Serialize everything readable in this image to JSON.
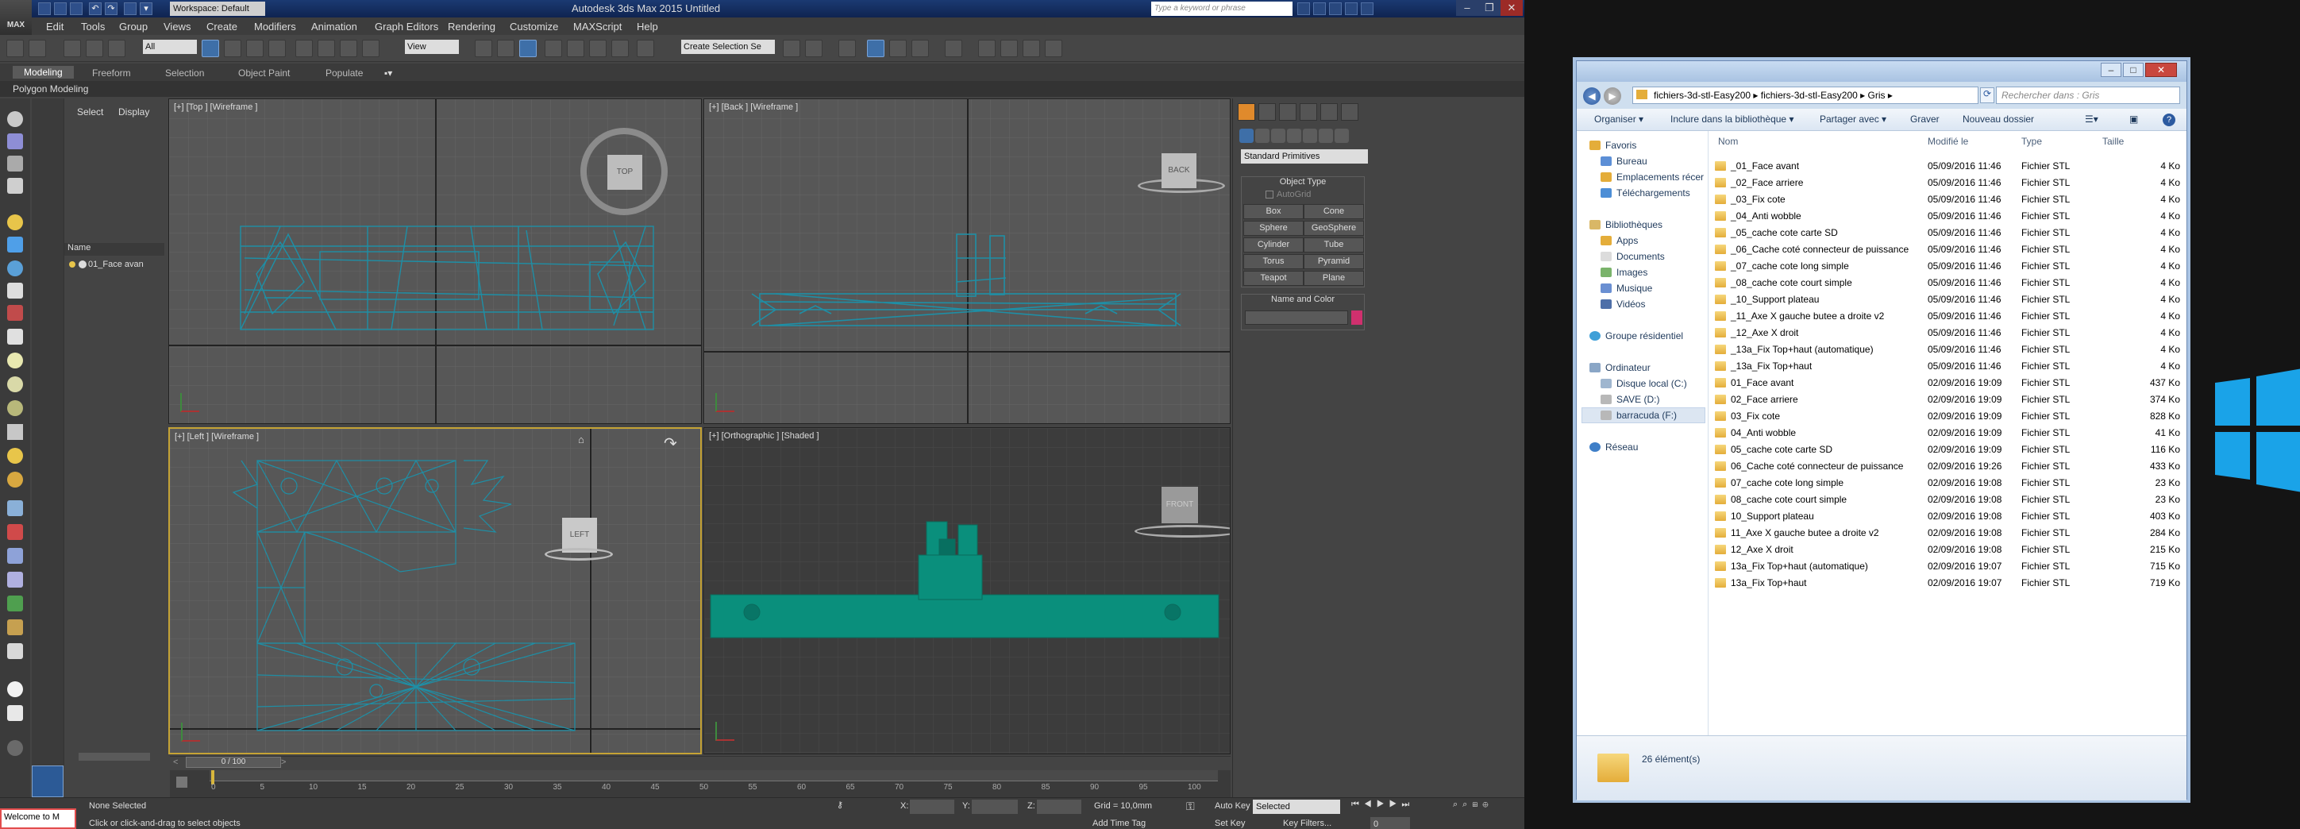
{
  "max": {
    "logo": "MAX",
    "workspace": "Workspace: Default",
    "title": "Autodesk 3ds Max 2015     Untitled",
    "search_placeholder": "Type a keyword or phrase",
    "menus": [
      "Edit",
      "Tools",
      "Group",
      "Views",
      "Create",
      "Modifiers",
      "Animation",
      "Graph Editors",
      "Rendering",
      "Customize",
      "MAXScript",
      "Help"
    ],
    "toolbar": {
      "selection_filter": "All",
      "ref_coord": "View",
      "named_selection": "Create Selection Se"
    },
    "ribbon_tabs": [
      "Modeling",
      "Freeform",
      "Selection",
      "Object Paint",
      "Populate"
    ],
    "ribbon_active": "Modeling",
    "polygon_modeling": "Polygon Modeling",
    "explorer": {
      "tabs": [
        "Select",
        "Display"
      ],
      "col_name": "Name",
      "item": "01_Face avan"
    },
    "viewports": {
      "top": {
        "label": "[+] [Top ] [Wireframe ]",
        "cube": "TOP"
      },
      "back": {
        "label": "[+] [Back ] [Wireframe ]",
        "cube": "BACK"
      },
      "left": {
        "label": "[+] [Left ] [Wireframe ]",
        "cube": "LEFT"
      },
      "persp": {
        "label": "[+] [Orthographic ] [Shaded ]",
        "cube": "FRONT"
      }
    },
    "command_panel": {
      "dropdown": "Standard Primitives",
      "object_type_title": "Object Type",
      "autogrid": "AutoGrid",
      "buttons": [
        "Box",
        "Cone",
        "Sphere",
        "GeoSphere",
        "Cylinder",
        "Tube",
        "Torus",
        "Pyramid",
        "Teapot",
        "Plane"
      ],
      "name_color_title": "Name and Color"
    },
    "time": {
      "slider": "0 / 100",
      "ticks": [
        "0",
        "5",
        "10",
        "15",
        "20",
        "25",
        "30",
        "35",
        "40",
        "45",
        "50",
        "55",
        "60",
        "65",
        "70",
        "75",
        "80",
        "85",
        "90",
        "95",
        "100"
      ]
    },
    "status": {
      "selected": "None Selected",
      "prompt": "Click or click-and-drag to select objects",
      "x": "X:",
      "y": "Y:",
      "z": "Z:",
      "grid": "Grid = 10,0mm",
      "add_time_tag": "Add Time Tag",
      "auto_key": "Auto Key",
      "set_key": "Set Key",
      "selected_dd": "Selected",
      "key_filters": "Key Filters...",
      "frame": "0",
      "maxscript": "Welcome to M"
    },
    "colors": {
      "mesh": "#1e8fa6",
      "shaded": "#0a8f7c",
      "name_swatch": "#d0306e"
    }
  },
  "explorer_window": {
    "path": [
      "fichiers-3d-stl-Easy200",
      "fichiers-3d-stl-Easy200",
      "Gris"
    ],
    "search_placeholder": "Rechercher dans : Gris",
    "commands": [
      "Organiser ▾",
      "Inclure dans la bibliothèque ▾",
      "Partager avec ▾",
      "Graver",
      "Nouveau dossier"
    ],
    "nav": {
      "favorites": "Favoris",
      "fav_items": [
        "Bureau",
        "Emplacements récer",
        "Téléchargements"
      ],
      "libraries": "Bibliothèques",
      "lib_items": [
        "Apps",
        "Documents",
        "Images",
        "Musique",
        "Vidéos"
      ],
      "homegroup": "Groupe résidentiel",
      "computer": "Ordinateur",
      "drives": [
        "Disque local (C:)",
        "SAVE (D:)",
        "barracuda (F:)"
      ],
      "network": "Réseau"
    },
    "columns": [
      "Nom",
      "Modifié le",
      "Type",
      "Taille"
    ],
    "files": [
      {
        "name": "_01_Face avant",
        "date": "05/09/2016 11:46",
        "type": "Fichier STL",
        "size": "4 Ko"
      },
      {
        "name": "_02_Face arriere",
        "date": "05/09/2016 11:46",
        "type": "Fichier STL",
        "size": "4 Ko"
      },
      {
        "name": "_03_Fix cote",
        "date": "05/09/2016 11:46",
        "type": "Fichier STL",
        "size": "4 Ko"
      },
      {
        "name": "_04_Anti wobble",
        "date": "05/09/2016 11:46",
        "type": "Fichier STL",
        "size": "4 Ko"
      },
      {
        "name": "_05_cache cote carte SD",
        "date": "05/09/2016 11:46",
        "type": "Fichier STL",
        "size": "4 Ko"
      },
      {
        "name": "_06_Cache coté connecteur de puissance",
        "date": "05/09/2016 11:46",
        "type": "Fichier STL",
        "size": "4 Ko"
      },
      {
        "name": "_07_cache cote long simple",
        "date": "05/09/2016 11:46",
        "type": "Fichier STL",
        "size": "4 Ko"
      },
      {
        "name": "_08_cache cote court simple",
        "date": "05/09/2016 11:46",
        "type": "Fichier STL",
        "size": "4 Ko"
      },
      {
        "name": "_10_Support plateau",
        "date": "05/09/2016 11:46",
        "type": "Fichier STL",
        "size": "4 Ko"
      },
      {
        "name": "_11_Axe X gauche butee a droite v2",
        "date": "05/09/2016 11:46",
        "type": "Fichier STL",
        "size": "4 Ko"
      },
      {
        "name": "_12_Axe X droit",
        "date": "05/09/2016 11:46",
        "type": "Fichier STL",
        "size": "4 Ko"
      },
      {
        "name": "_13a_Fix Top+haut (automatique)",
        "date": "05/09/2016 11:46",
        "type": "Fichier STL",
        "size": "4 Ko"
      },
      {
        "name": "_13a_Fix Top+haut",
        "date": "05/09/2016 11:46",
        "type": "Fichier STL",
        "size": "4 Ko"
      },
      {
        "name": "01_Face avant",
        "date": "02/09/2016 19:09",
        "type": "Fichier STL",
        "size": "437 Ko"
      },
      {
        "name": "02_Face arriere",
        "date": "02/09/2016 19:09",
        "type": "Fichier STL",
        "size": "374 Ko"
      },
      {
        "name": "03_Fix cote",
        "date": "02/09/2016 19:09",
        "type": "Fichier STL",
        "size": "828 Ko"
      },
      {
        "name": "04_Anti wobble",
        "date": "02/09/2016 19:09",
        "type": "Fichier STL",
        "size": "41 Ko"
      },
      {
        "name": "05_cache cote carte SD",
        "date": "02/09/2016 19:09",
        "type": "Fichier STL",
        "size": "116 Ko"
      },
      {
        "name": "06_Cache coté connecteur de puissance",
        "date": "02/09/2016 19:26",
        "type": "Fichier STL",
        "size": "433 Ko"
      },
      {
        "name": "07_cache cote long simple",
        "date": "02/09/2016 19:08",
        "type": "Fichier STL",
        "size": "23 Ko"
      },
      {
        "name": "08_cache cote court simple",
        "date": "02/09/2016 19:08",
        "type": "Fichier STL",
        "size": "23 Ko"
      },
      {
        "name": "10_Support plateau",
        "date": "02/09/2016 19:08",
        "type": "Fichier STL",
        "size": "403 Ko"
      },
      {
        "name": "11_Axe X gauche butee a droite v2",
        "date": "02/09/2016 19:08",
        "type": "Fichier STL",
        "size": "284 Ko"
      },
      {
        "name": "12_Axe X droit",
        "date": "02/09/2016 19:08",
        "type": "Fichier STL",
        "size": "215 Ko"
      },
      {
        "name": "13a_Fix Top+haut (automatique)",
        "date": "02/09/2016 19:07",
        "type": "Fichier STL",
        "size": "715 Ko"
      },
      {
        "name": "13a_Fix Top+haut",
        "date": "02/09/2016 19:07",
        "type": "Fichier STL",
        "size": "719 Ko"
      }
    ],
    "count": "26 élément(s)"
  },
  "desktop": {
    "logo_color": "#1aa3e8"
  }
}
